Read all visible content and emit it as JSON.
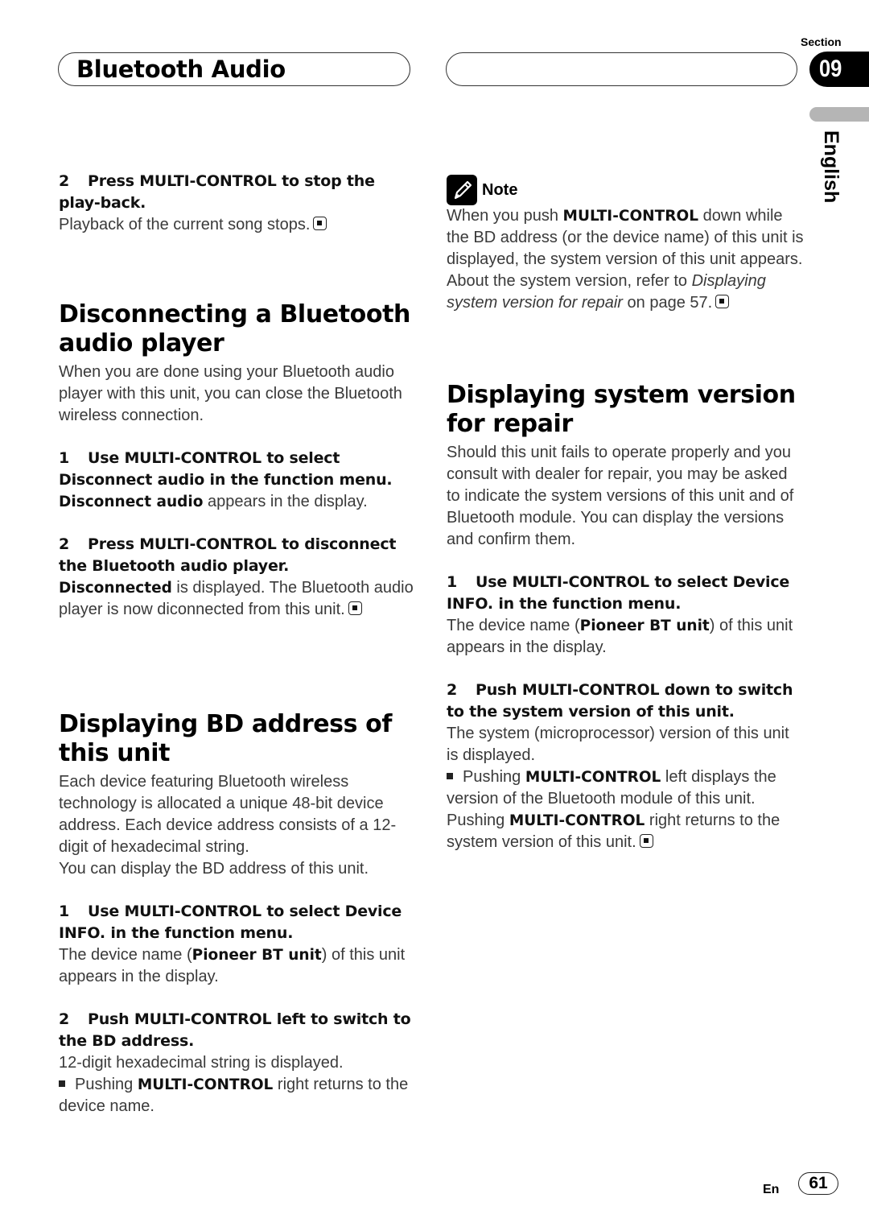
{
  "header": {
    "title": "Bluetooth Audio",
    "section_label": "Section",
    "section_number": "09",
    "language": "English"
  },
  "left_column": {
    "top_step": {
      "number": "2",
      "heading": "Press MULTI-CONTROL to stop the play-back.",
      "body": "Playback of the current song stops."
    },
    "disconnect": {
      "title": "Disconnecting a Bluetooth audio player",
      "intro": "When you are done using your Bluetooth audio player with this unit, you can close the Bluetooth wireless connection.",
      "steps": [
        {
          "number": "1",
          "heading": "Use MULTI-CONTROL to select Disconnect audio in the function menu.",
          "body_bold": "Disconnect audio",
          "body": " appears in the display."
        },
        {
          "number": "2",
          "heading": "Press MULTI-CONTROL to disconnect the Bluetooth audio player.",
          "body_bold": "Disconnected",
          "body": " is displayed. The Bluetooth audio player is now diconnected from this unit."
        }
      ]
    },
    "bd_address": {
      "title": "Displaying BD address of this unit",
      "intro": "Each device featuring Bluetooth wireless technology is allocated a unique 48-bit device address. Each device address consists of a 12-digit of hexadecimal string.",
      "intro2": "You can display the BD address of this unit.",
      "steps": [
        {
          "number": "1",
          "heading": "Use MULTI-CONTROL to select Device INFO. in the function menu.",
          "body_pre": "The device name (",
          "body_bold": "Pioneer BT unit",
          "body_post": ") of this unit appears in the display."
        },
        {
          "number": "2",
          "heading": "Push MULTI-CONTROL left to switch to the BD address.",
          "body": "12-digit hexadecimal string is displayed.",
          "bullet_pre": "Pushing ",
          "bullet_bold": "MULTI-CONTROL",
          "bullet_post": " right returns to the device name."
        }
      ]
    }
  },
  "right_column": {
    "note": {
      "label": "Note",
      "text_pre": "When you push ",
      "text_bold": "MULTI-CONTROL",
      "text_mid": " down while the BD address (or the device name) of this unit is displayed, the system version of this unit appears. About the system version, refer to ",
      "text_italic": "Displaying system version for repair",
      "text_post": " on page 57."
    },
    "system_version": {
      "title": "Displaying system version for repair",
      "intro": "Should this unit fails to operate properly and you consult with dealer for repair, you may be asked to indicate the system versions of this unit and of Bluetooth module. You can display the versions and confirm them.",
      "steps": [
        {
          "number": "1",
          "heading": "Use MULTI-CONTROL to select Device INFO. in the function menu.",
          "body_pre": "The device name (",
          "body_bold": "Pioneer BT unit",
          "body_post": ") of this unit appears in the display."
        },
        {
          "number": "2",
          "heading": "Push MULTI-CONTROL down to switch to the system version of this unit.",
          "body": "The system (microprocessor) version of this unit is displayed.",
          "bullet_pre": "Pushing ",
          "bullet_bold": "MULTI-CONTROL",
          "bullet_post": " left displays the version of the Bluetooth module of this unit.",
          "extra_pre": "Pushing ",
          "extra_bold": "MULTI-CONTROL",
          "extra_post": " right returns to the system version of this unit."
        }
      ]
    }
  },
  "footer": {
    "lang_code": "En",
    "page_number": "61"
  }
}
